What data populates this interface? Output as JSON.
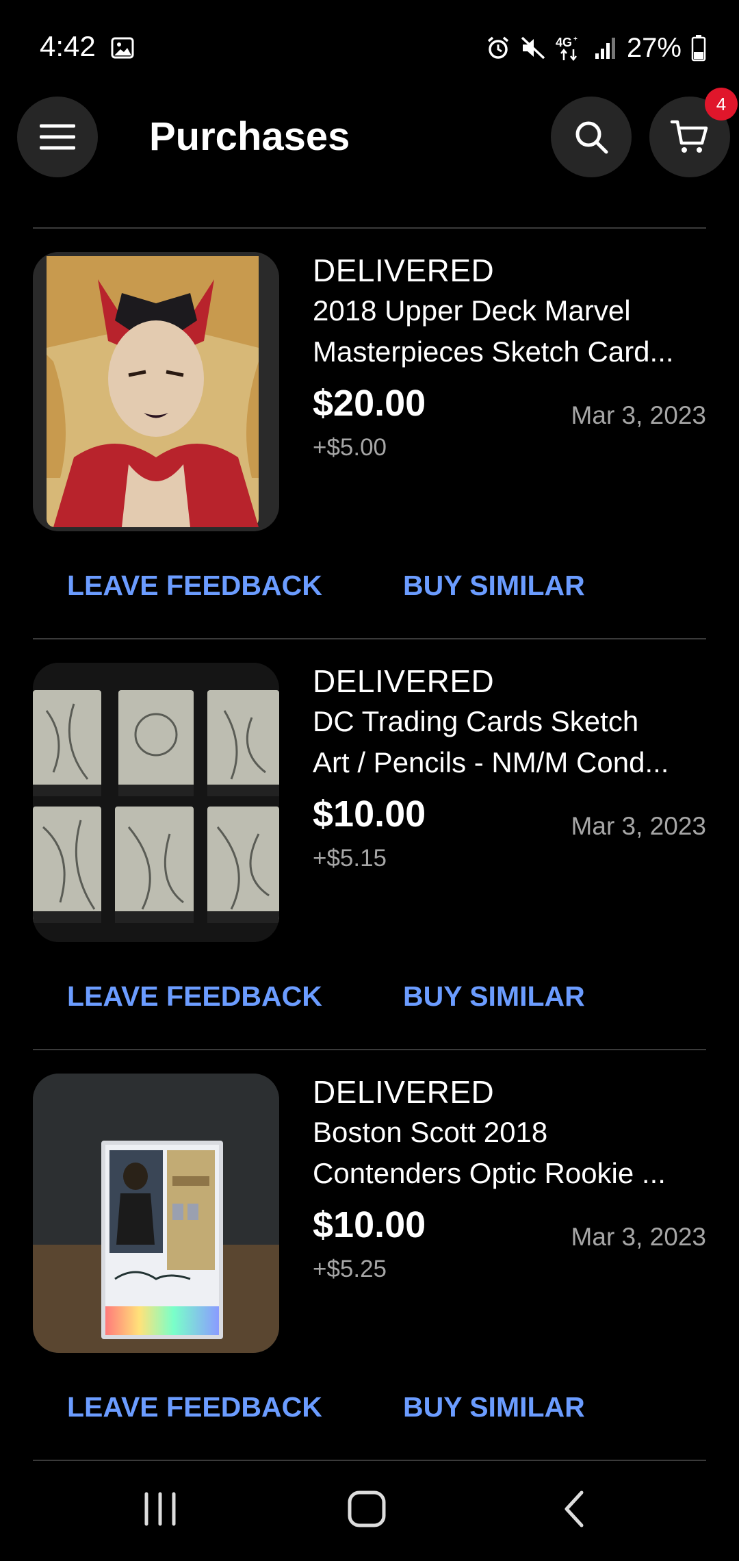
{
  "status_bar": {
    "time": "4:42",
    "battery": "27%",
    "icons": [
      "image-icon",
      "alarm-icon",
      "mute-icon",
      "4g-data-icon",
      "signal-icon",
      "battery-icon"
    ]
  },
  "header": {
    "title": "Purchases",
    "cart_count": "4",
    "icons": [
      "menu-icon",
      "search-icon",
      "cart-icon"
    ]
  },
  "purchases": [
    {
      "status": "DELIVERED",
      "title_line1": "2018 Upper Deck Marvel",
      "title_line2": "Masterpieces Sketch Card...",
      "price": "$20.00",
      "shipping": "+$5.00",
      "date": "Mar 3, 2023",
      "action_feedback": "LEAVE FEEDBACK",
      "action_similar": "BUY SIMILAR"
    },
    {
      "status": "DELIVERED",
      "title_line1": "DC Trading Cards Sketch",
      "title_line2": "Art / Pencils - NM/M Cond...",
      "price": "$10.00",
      "shipping": "+$5.15",
      "date": "Mar 3, 2023",
      "action_feedback": "LEAVE FEEDBACK",
      "action_similar": "BUY SIMILAR"
    },
    {
      "status": "DELIVERED",
      "title_line1": "Boston Scott 2018",
      "title_line2": "Contenders Optic Rookie ...",
      "price": "$10.00",
      "shipping": "+$5.25",
      "date": "Mar 3, 2023",
      "action_feedback": "LEAVE FEEDBACK",
      "action_similar": "BUY SIMILAR"
    }
  ],
  "colors": {
    "background": "#000000",
    "accent_link": "#6b9cff",
    "badge": "#e0162b",
    "muted_text": "#a6a6a6"
  },
  "nav_bar": {
    "icons": [
      "recent-apps-icon",
      "home-icon",
      "back-icon"
    ]
  }
}
